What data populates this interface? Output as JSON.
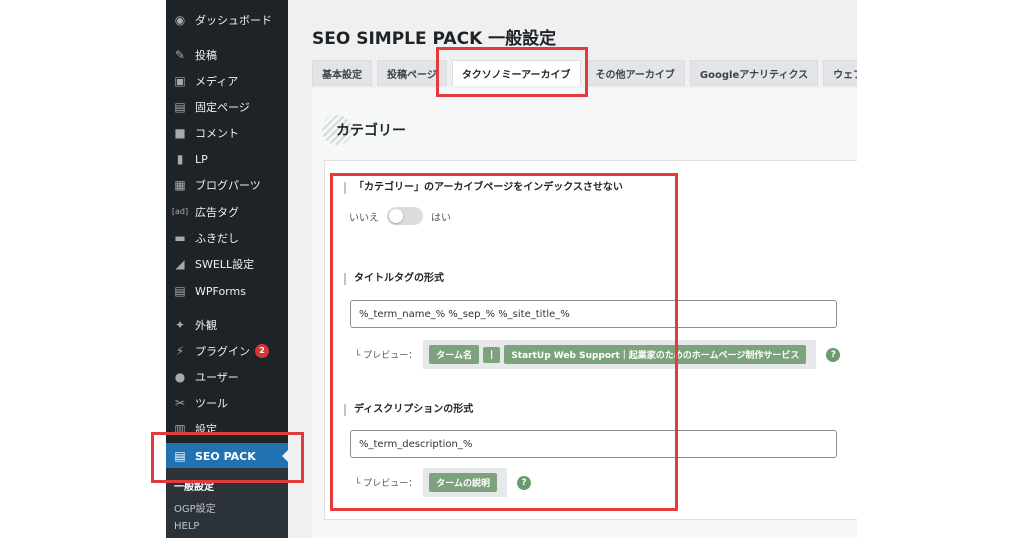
{
  "sidebar": {
    "items": [
      {
        "icon": "dashboard-icon",
        "glyph": "◉",
        "label": "ダッシュボード"
      },
      {
        "icon": "pushpin-icon",
        "glyph": "✎",
        "label": "投稿"
      },
      {
        "icon": "media-icon",
        "glyph": "▣",
        "label": "メディア"
      },
      {
        "icon": "page-icon",
        "glyph": "▤",
        "label": "固定ページ"
      },
      {
        "icon": "comment-icon",
        "glyph": "■",
        "label": "コメント"
      },
      {
        "icon": "lp-icon",
        "glyph": "▮",
        "label": "LP"
      },
      {
        "icon": "blog-parts-icon",
        "glyph": "▦",
        "label": "ブログパーツ"
      },
      {
        "icon": "ad-icon",
        "glyph": "[ad]",
        "label": "広告タグ"
      },
      {
        "icon": "balloon-icon",
        "glyph": "▬",
        "label": "ふきだし"
      },
      {
        "icon": "swell-icon",
        "glyph": "◢",
        "label": "SWELL設定"
      },
      {
        "icon": "wpforms-icon",
        "glyph": "▤",
        "label": "WPForms"
      },
      {
        "icon": "appearance-icon",
        "glyph": "✦",
        "label": "外観"
      },
      {
        "icon": "plugin-icon",
        "glyph": "⚡",
        "label": "プラグイン",
        "badge": "2"
      },
      {
        "icon": "user-icon",
        "glyph": "●",
        "label": "ユーザー"
      },
      {
        "icon": "tools-icon",
        "glyph": "✂",
        "label": "ツール"
      },
      {
        "icon": "settings-icon",
        "glyph": "▥",
        "label": "設定"
      }
    ],
    "active_item": {
      "icon": "seo-pack-icon",
      "glyph": "▤",
      "label": "SEO PACK"
    },
    "submenu": [
      {
        "label": "一般設定",
        "current": true
      },
      {
        "label": "OGP設定",
        "current": false
      },
      {
        "label": "HELP",
        "current": false
      }
    ]
  },
  "page": {
    "title": "SEO SIMPLE PACK 一般設定"
  },
  "tabs": [
    {
      "label": "基本設定",
      "active": false
    },
    {
      "label": "投稿ページ",
      "active": false
    },
    {
      "label": "タクソノミーアーカイブ",
      "active": true
    },
    {
      "label": "その他アーカイブ",
      "active": false
    },
    {
      "label": "Googleアナリティクス",
      "active": false
    },
    {
      "label": "ウェブマスターツール",
      "active": false
    }
  ],
  "section": {
    "title": "カテゴリー"
  },
  "noindex": {
    "label": "「カテゴリー」のアーカイブページをインデックスさせない",
    "off_label": "いいえ",
    "on_label": "はい",
    "enabled": false
  },
  "title_format": {
    "label": "タイトルタグの形式",
    "value": "%_term_name_% %_sep_% %_site_title_%",
    "preview_label": "└ プレビュー：",
    "chips": [
      "ターム名",
      "|",
      "StartUp Web Support｜起業家のためのホームページ制作サービス"
    ]
  },
  "description_format": {
    "label": "ディスクリプションの形式",
    "value": "%_term_description_%",
    "preview_label": "└ プレビュー：",
    "chips": [
      "タームの説明"
    ]
  },
  "help_glyph": "?",
  "colors": {
    "sidebar_bg": "#1d2327",
    "active_blue": "#2271b1",
    "chip_green": "#7da27e",
    "highlight_red": "#e23b3b"
  }
}
